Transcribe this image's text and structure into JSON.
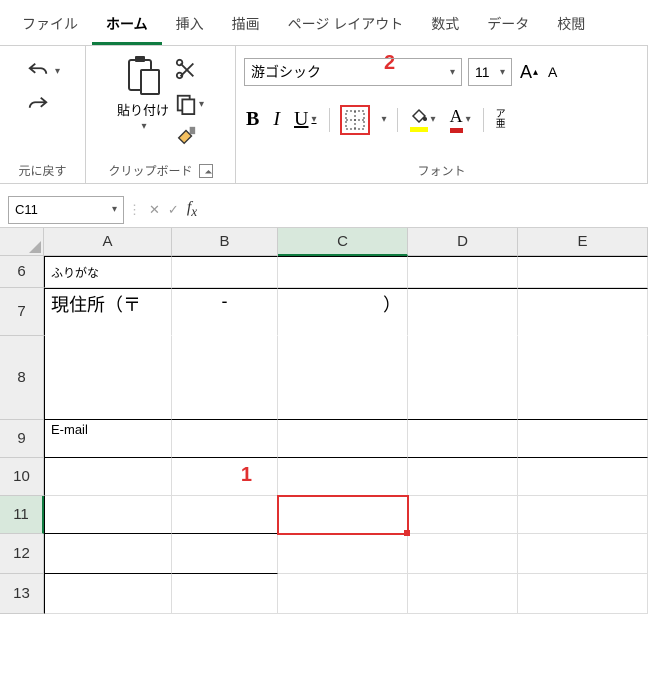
{
  "tabs": {
    "file": "ファイル",
    "home": "ホーム",
    "insert": "挿入",
    "draw": "描画",
    "pagelayout": "ページ レイアウト",
    "formulas": "数式",
    "data": "データ",
    "review": "校閲"
  },
  "ribbon": {
    "undo_group": "元に戻す",
    "clipboard_group": "クリップボード",
    "paste_label": "貼り付け",
    "font_group": "フォント",
    "font_name": "游ゴシック",
    "font_size": "11",
    "phonetic": "ア\n亜"
  },
  "callouts": {
    "one": "1",
    "two": "2"
  },
  "namebox": "C11",
  "columns": {
    "A": "A",
    "B": "B",
    "C": "C",
    "D": "D",
    "E": "E"
  },
  "rows": {
    "r6": "6",
    "r7": "7",
    "r8": "8",
    "r9": "9",
    "r10": "10",
    "r11": "11",
    "r12": "12",
    "r13": "13"
  },
  "cells": {
    "a6": "ふりがな",
    "a7": "現住所（〒",
    "b7": "-",
    "c7": "）",
    "a9": "E-mail"
  }
}
